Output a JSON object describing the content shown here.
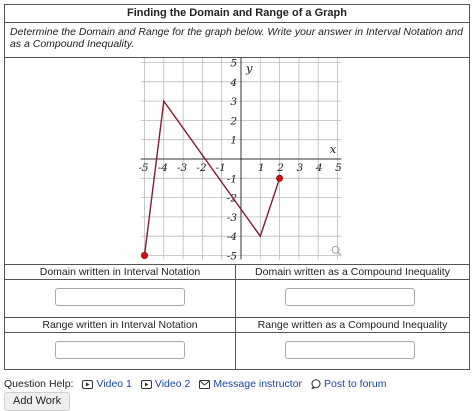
{
  "problem": {
    "title": "Finding the Domain and Range of a Graph",
    "instructions": "Determine the Domain and Range for the graph below. Write your answer in Interval Notation and as a Compound Inequality."
  },
  "graph": {
    "x_axis_label": "x",
    "y_axis_label": "y",
    "x_ticks": [
      "-5",
      "-4",
      "-3",
      "-2",
      "-1",
      "1",
      "2",
      "3",
      "4",
      "5"
    ],
    "y_ticks": [
      "5",
      "4",
      "3",
      "2",
      "1",
      "-1",
      "-2",
      "-3",
      "-4",
      "-5"
    ],
    "line_color": "#8b1a2b",
    "point_color": "#cc1111",
    "polyline_points": [
      [
        -5,
        -5
      ],
      [
        -4,
        3
      ],
      [
        1,
        -4
      ],
      [
        2,
        -1
      ]
    ],
    "closed_endpoints": [
      [
        -5,
        -5
      ],
      [
        2,
        -1
      ]
    ]
  },
  "answers": {
    "domain_interval_label": "Domain written in Interval Notation",
    "domain_compound_label": "Domain written as a Compound Inequality",
    "range_interval_label": "Range written in Interval Notation",
    "range_compound_label": "Range written as a Compound Inequality",
    "domain_interval_value": "",
    "domain_compound_value": "",
    "range_interval_value": "",
    "range_compound_value": ""
  },
  "help": {
    "label": "Question Help:",
    "video1": "Video 1",
    "video2": "Video 2",
    "message": "Message instructor",
    "forum": "Post to forum",
    "add_work": "Add Work"
  },
  "icons": {
    "video": "video-icon",
    "message": "envelope-icon",
    "forum": "speech-bubble-icon",
    "zoom": "magnifier-icon"
  }
}
